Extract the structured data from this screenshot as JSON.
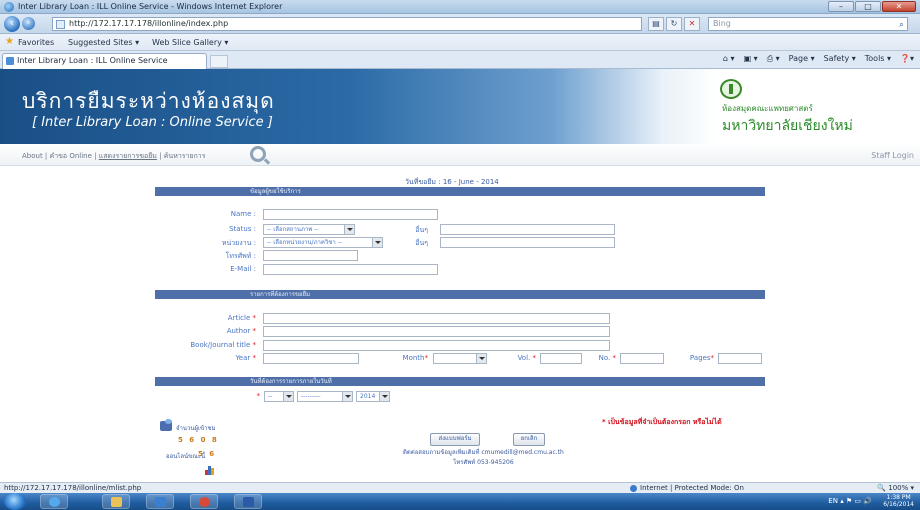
{
  "window": {
    "title": "Inter Library Loan : ILL Online Service - Windows Internet Explorer",
    "controls": [
      "–",
      "□",
      "✕"
    ]
  },
  "addressbar": {
    "url": "http://172.17.17.178/illonline/index.php",
    "search_placeholder": "Bing"
  },
  "favorites": {
    "label": "Favorites",
    "items": [
      "Suggested Sites ▾",
      "Web Slice Gallery ▾"
    ]
  },
  "tab": {
    "label": "Inter Library Loan : ILL Online Service"
  },
  "commandbar": [
    "Page ▾",
    "Safety ▾",
    "Tools ▾",
    "❓▾"
  ],
  "banner": {
    "thai_title": "บริการยืมระหว่างห้องสมุด",
    "english_title": "[ Inter Library Loan : Online Service ]",
    "library_name": "ห้องสมุดคณะแพทยศาสตร์",
    "university_name": "มหาวิทยาลัยเชียงใหม่"
  },
  "nav": {
    "about": "About",
    "links": [
      "คำขอ Online",
      "แสดงรายการขอยืม",
      "ค้นหารายการ"
    ],
    "staff_login": "Staff Login"
  },
  "form": {
    "date_line": "วันที่ขอยืม : 16 - June - 2014",
    "section_user": "ข้อมูลผู้ขอใช้บริการ",
    "name_label": "Name :",
    "status_label": "Status :",
    "status_value": "-- เลือกสถานภาพ --",
    "other_label_1": "อื่นๆ",
    "dept_label": "หน่วยงาน :",
    "dept_value": "-- เลือกหน่วยงาน/ภาควิชา --",
    "other_label_2": "อื่นๆ",
    "phone_label": "โทรศัพท์ :",
    "email_label": "E-Mail :",
    "section_item": "รายการที่ต้องการขอยืม",
    "article_label": "Article",
    "author_label": "Author",
    "book_label": "Book/Journal title",
    "year_label": "Year",
    "month_label": "Month",
    "vol_label": "Vol.",
    "no_label": "No.",
    "pages_label": "Pages",
    "section_date": "วันที่ต้องการรายการภายในวันที่",
    "day_value": "--",
    "month_value": "---------",
    "year_value": "2014",
    "required_note": "* เป็นข้อมูลที่จำเป็นต้องกรอก หรือไม่ได้",
    "submit_label": "ส่งแบบฟอร์ม",
    "cancel_label": "ยกเลิก",
    "contact_line_1": "ติดต่อสอบถามข้อมูลเพิ่มเติมที่ cmumedill@med.cmu.ac.th",
    "contact_line_2": "โทรศัพท์ 053-945206"
  },
  "counter": {
    "label": "จำนวนผู้เข้าชม",
    "digits": "5 6 0 8",
    "online_label": "ออนไลน์ขณะนี้",
    "online_digits": "5 6"
  },
  "statusbar": {
    "url": "http://172.17.17.178/illonline/mlist.php",
    "zone": "Internet | Protected Mode: On",
    "zoom": "100% ▾"
  },
  "taskbar": {
    "language": "EN",
    "time": "1:38 PM",
    "date": "6/16/2014"
  },
  "colors": {
    "banner_dark": "#1a4f86",
    "section_header": "#4e6fa8",
    "label_blue": "#4a76c4",
    "required_red": "#e0141e",
    "brand_green": "#2b8a2a"
  }
}
